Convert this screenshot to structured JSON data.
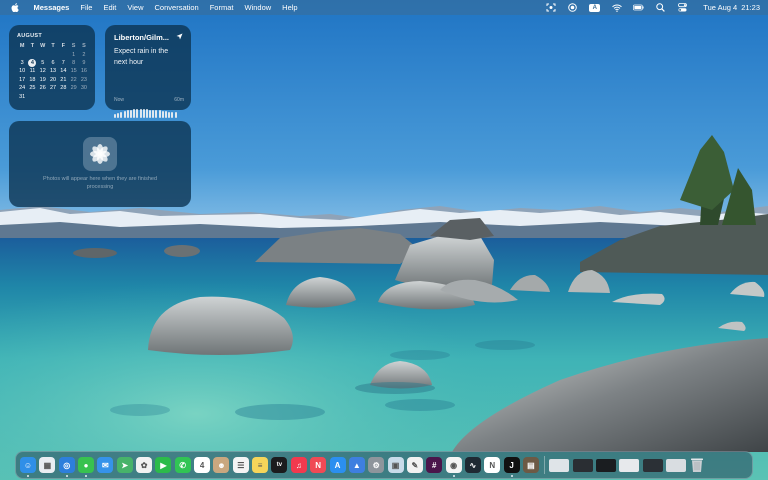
{
  "menubar": {
    "apple_icon": "apple-logo-icon",
    "app_name": "Messages",
    "menus": [
      "File",
      "Edit",
      "View",
      "Conversation",
      "Format",
      "Window",
      "Help"
    ],
    "status_icons": [
      "screen-capture-icon",
      "record-icon",
      "keyboard-input-icon",
      "wifi-icon",
      "battery-icon",
      "spotlight-search-icon",
      "control-center-icon"
    ],
    "input_source": "A",
    "date": "Tue Aug 4",
    "time": "21:23"
  },
  "calendar_widget": {
    "month": "AUGUST",
    "weekdays": [
      "M",
      "T",
      "W",
      "T",
      "F",
      "S",
      "S"
    ],
    "lead_blanks": 5,
    "days": [
      "1",
      "2",
      "3",
      "4",
      "5",
      "6",
      "7",
      "8",
      "9",
      "10",
      "11",
      "12",
      "13",
      "14",
      "15",
      "16",
      "17",
      "18",
      "19",
      "20",
      "21",
      "22",
      "23",
      "24",
      "25",
      "26",
      "27",
      "28",
      "29",
      "30",
      "31"
    ],
    "today": "4"
  },
  "weather_widget": {
    "location": "Liberton/Gilm...",
    "forecast": "Expect rain in the next hour",
    "axis_start": "Now",
    "axis_end": "60m",
    "precipitation_levels": [
      0.45,
      0.55,
      0.65,
      0.75,
      0.85,
      0.9,
      0.95,
      1,
      1,
      1,
      0.95,
      0.9,
      0.9,
      0.9,
      0.85,
      0.8,
      0.75,
      0.7,
      0.7,
      0.65
    ]
  },
  "photos_widget": {
    "message": "Photos will appear here when they are finished processing"
  },
  "dock": {
    "apps": [
      {
        "name": "finder",
        "color": "#2f8fe8",
        "glyph": "☺",
        "running": true
      },
      {
        "name": "launchpad",
        "color": "#e9edf2",
        "glyph": "▦",
        "running": false
      },
      {
        "name": "safari",
        "color": "#2d7fdc",
        "glyph": "◎",
        "running": true
      },
      {
        "name": "messages",
        "color": "#38c24f",
        "glyph": "●",
        "running": true
      },
      {
        "name": "mail",
        "color": "#3593ea",
        "glyph": "✉",
        "running": false
      },
      {
        "name": "maps",
        "color": "#47b36a",
        "glyph": "➤",
        "running": false
      },
      {
        "name": "photos",
        "color": "#f2f2f2",
        "glyph": "✿",
        "running": false
      },
      {
        "name": "facetime",
        "color": "#2cbb4a",
        "glyph": "▶",
        "running": false
      },
      {
        "name": "phone",
        "color": "#31c454",
        "glyph": "✆",
        "running": false
      },
      {
        "name": "calendar",
        "color": "#ffffff",
        "glyph": "4",
        "running": false
      },
      {
        "name": "contacts",
        "color": "#c9a77f",
        "glyph": "☻",
        "running": false
      },
      {
        "name": "reminders",
        "color": "#f4f4f4",
        "glyph": "☰",
        "running": false
      },
      {
        "name": "notes",
        "color": "#f6d55a",
        "glyph": "≡",
        "running": false
      },
      {
        "name": "apple-tv",
        "color": "#1b1b1d",
        "glyph": "tv",
        "running": false
      },
      {
        "name": "music",
        "color": "#f2394e",
        "glyph": "♫",
        "running": false
      },
      {
        "name": "news",
        "color": "#f04a55",
        "glyph": "N",
        "running": false
      },
      {
        "name": "app-store",
        "color": "#2b8ff0",
        "glyph": "A",
        "running": false
      },
      {
        "name": "keynote",
        "color": "#3e7fe0",
        "glyph": "▲",
        "running": false
      },
      {
        "name": "system-settings",
        "color": "#8e959c",
        "glyph": "⚙",
        "running": false
      },
      {
        "name": "preview",
        "color": "#c9dbe9",
        "glyph": "▣",
        "running": false
      },
      {
        "name": "textedit",
        "color": "#f1f1f1",
        "glyph": "✎",
        "running": false
      },
      {
        "name": "slack",
        "color": "#4a154b",
        "glyph": "#",
        "running": false
      },
      {
        "name": "chrome",
        "color": "#f4f4f4",
        "glyph": "◉",
        "running": true
      },
      {
        "name": "activity-monitor",
        "color": "#1f2a33",
        "glyph": "∿",
        "running": false
      },
      {
        "name": "news-reader",
        "color": "#ffffff",
        "glyph": "N",
        "running": false
      },
      {
        "name": "jetbrains-ide",
        "color": "#111111",
        "glyph": "J",
        "running": true
      },
      {
        "name": "image-viewer",
        "color": "#6d5a45",
        "glyph": "▤",
        "running": false
      }
    ],
    "recent_windows": [
      {
        "name": "minimized-window-1",
        "color": "#dfe4e8"
      },
      {
        "name": "minimized-window-2",
        "color": "#2a2e33"
      },
      {
        "name": "minimized-window-3",
        "color": "#1a1d20"
      },
      {
        "name": "minimized-window-4",
        "color": "#e7e9ec"
      },
      {
        "name": "minimized-window-5",
        "color": "#2b3036"
      },
      {
        "name": "minimized-window-6",
        "color": "#d9dde1"
      }
    ],
    "trash_icon": "trash-icon"
  }
}
